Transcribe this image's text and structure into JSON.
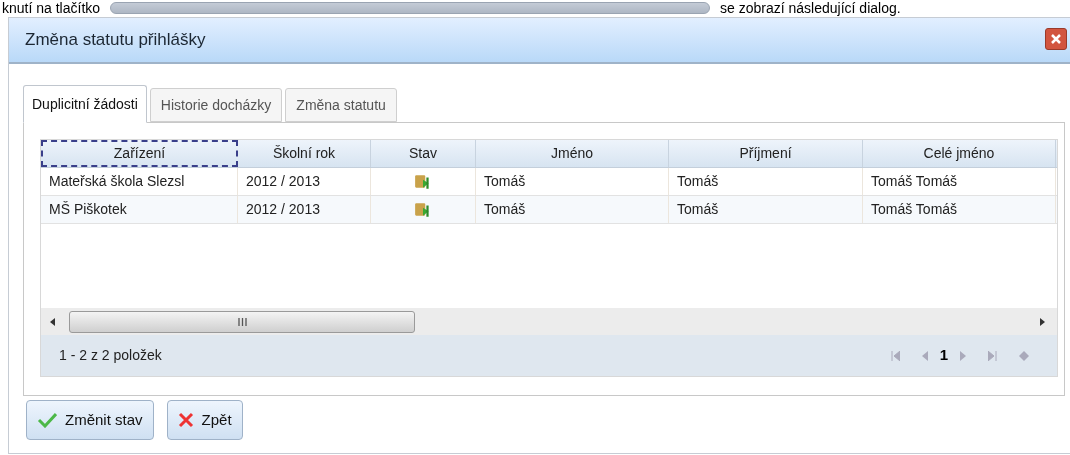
{
  "intro_text": {
    "before": "knutí na tlačítko",
    "after": "se zobrazí následující dialog."
  },
  "window": {
    "title": "Změna statutu přihlášky"
  },
  "tabs": [
    {
      "label": "Duplicitní žádosti",
      "selected": true
    },
    {
      "label": "Historie docházky",
      "selected": false
    },
    {
      "label": "Změna statutu",
      "selected": false
    }
  ],
  "table": {
    "columns": [
      {
        "label": "Zařízení",
        "focused": true,
        "kind": "text"
      },
      {
        "label": "Školní rok",
        "focused": false,
        "kind": "text"
      },
      {
        "label": "Stav",
        "focused": false,
        "kind": "icon"
      },
      {
        "label": "Jméno",
        "focused": false,
        "kind": "text"
      },
      {
        "label": "Příjmení",
        "focused": false,
        "kind": "text"
      },
      {
        "label": "Celé jméno",
        "focused": false,
        "kind": "text"
      }
    ],
    "rows": [
      {
        "cells": [
          "Mateřská škola Slezsl",
          "2012 / 2013",
          "",
          "Tomáš",
          "Tomáš",
          "Tomáš Tomáš"
        ]
      },
      {
        "cells": [
          "MŠ Piškotek",
          "2012 / 2013",
          "",
          "Tomáš",
          "Tomáš",
          "Tomáš Tomáš"
        ]
      }
    ]
  },
  "pager": {
    "summary": "1 - 2 z 2 položek",
    "page": "1"
  },
  "buttons": [
    {
      "label": "Změnit stav",
      "kind": "confirm"
    },
    {
      "label": "Zpět",
      "kind": "back"
    }
  ]
}
